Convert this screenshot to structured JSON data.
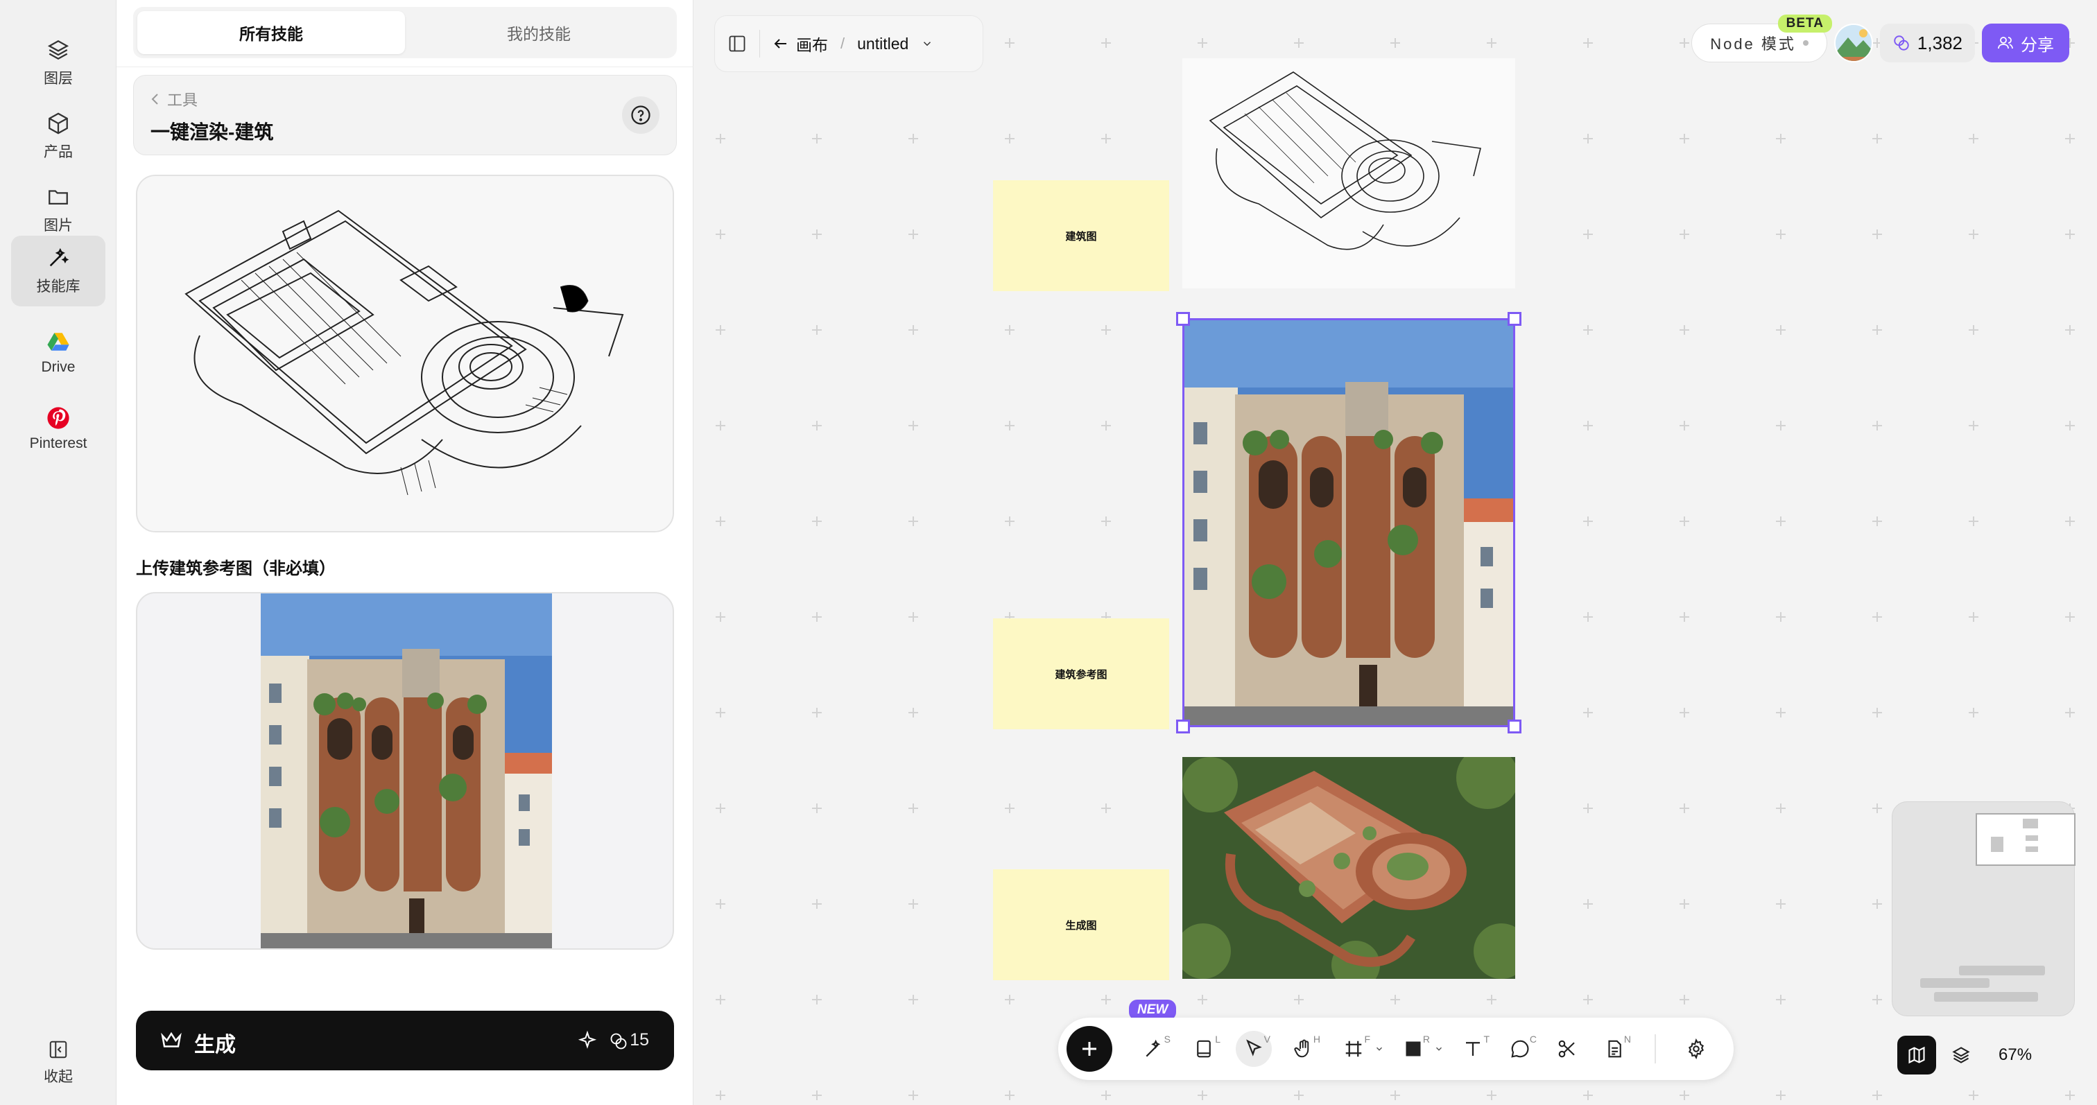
{
  "rail": {
    "items": [
      {
        "label": "图层",
        "icon": "layers-icon"
      },
      {
        "label": "产品",
        "icon": "box-icon"
      },
      {
        "label": "图片",
        "icon": "folder-icon"
      },
      {
        "label": "技能库",
        "icon": "magic-wand-icon"
      },
      {
        "label": "Drive",
        "icon": "google-drive-icon"
      },
      {
        "label": "Pinterest",
        "icon": "pinterest-icon"
      }
    ],
    "collapse_label": "收起"
  },
  "panel": {
    "tabs": [
      {
        "label": "所有技能"
      },
      {
        "label": "我的技能"
      }
    ],
    "tool_back": "工具",
    "tool_title": "一键渲染-建筑",
    "ref_label": "上传建筑参考图（非必填）",
    "generate_label": "生成",
    "generate_cost": "15"
  },
  "header": {
    "back_label": "画布",
    "file_name": "untitled",
    "node_mode": "Node 模式",
    "beta": "BETA",
    "credits": "1,382",
    "share": "分享"
  },
  "canvas": {
    "notes": [
      "建筑图",
      "建筑参考图",
      "生成图"
    ]
  },
  "toolbar": {
    "new_badge": "NEW",
    "keys": [
      "S",
      "L",
      "V",
      "H",
      "F",
      "R",
      "T",
      "C",
      "N"
    ]
  },
  "zoom": "67%",
  "colors": {
    "accent": "#7e5af4",
    "note": "#fdf8c4",
    "beta": "#c6f06b"
  }
}
